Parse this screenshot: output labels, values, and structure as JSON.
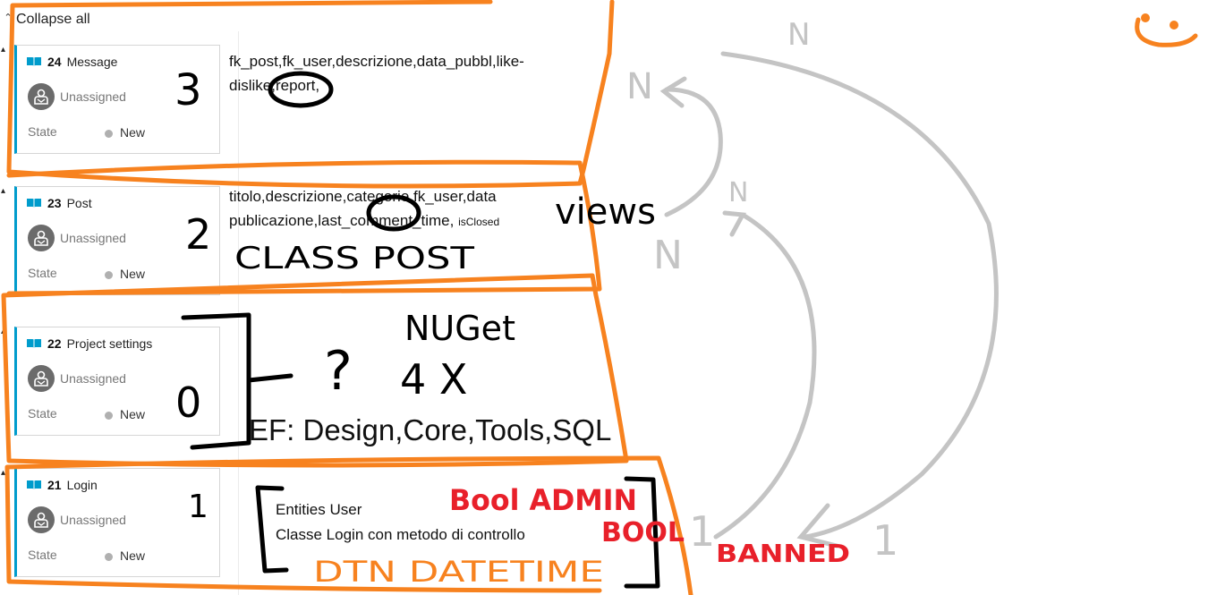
{
  "board": {
    "collapse_label": "Collapse all",
    "items": [
      {
        "id": "24",
        "name": "Message",
        "assignee": "Unassigned",
        "state_label": "State",
        "state": "New"
      },
      {
        "id": "23",
        "name": "Post",
        "assignee": "Unassigned",
        "state_label": "State",
        "state": "New"
      },
      {
        "id": "22",
        "name": "Project settings",
        "assignee": "Unassigned",
        "state_label": "State",
        "state": "New"
      },
      {
        "id": "21",
        "name": "Login",
        "assignee": "Unassigned",
        "state_label": "State",
        "state": "New"
      }
    ]
  },
  "notes": {
    "message_line1": "fk_post,fk_user,descrizione,data_pubbl,like-",
    "message_line2": "dislike,report,",
    "post_line1": "titolo,descrizione,categorie,fk_user,data",
    "post_line2": "publicazione,last_comment_time,",
    "post_small": "isClosed",
    "ef": "EF: Design,Core,Tools,SQL",
    "entities_line1": "Entities User",
    "entities_line2": "Classe Login con metodo di controllo"
  },
  "handwriting": {
    "n3": "3",
    "n2": "2",
    "n0": "0",
    "n1": "1",
    "views": "views",
    "class_post": "CLASS POST",
    "nuget": "NUGet",
    "question": "?",
    "times4": "4 X",
    "bool_admin": "Bool ADMIN",
    "bool": "BOOL",
    "banned": "BANNED",
    "dt_datetime": "DTN DATETIME",
    "n_gray1": "N",
    "n_gray2": "N",
    "n_gray3": "N",
    "n_gray4": "N",
    "one_gray1": "1",
    "one_gray2": "1",
    "smiley": "◡"
  },
  "colors": {
    "accent": "#009ccc",
    "orange": "#f7821f",
    "red": "#e8202a",
    "gray_ink": "#c4c4c4",
    "black_ink": "#000000"
  }
}
